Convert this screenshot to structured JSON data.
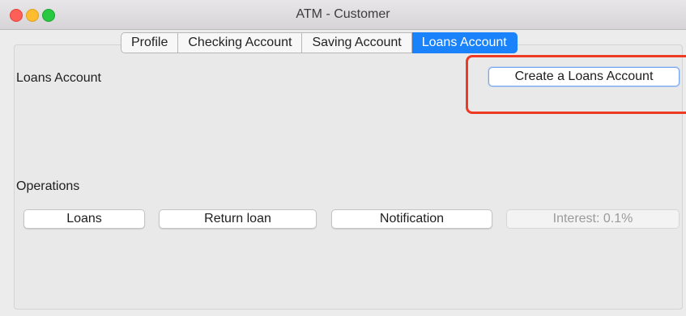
{
  "window": {
    "title": "ATM - Customer"
  },
  "tabs": [
    {
      "label": "Profile",
      "active": false
    },
    {
      "label": "Checking Account",
      "active": false
    },
    {
      "label": "Saving Account",
      "active": false
    },
    {
      "label": "Loans Account",
      "active": true
    }
  ],
  "panel": {
    "section_title": "Loans Account",
    "create_button": "Create a Loans Account",
    "operations_title": "Operations",
    "operations": {
      "loans": "Loans",
      "return_loan": "Return loan",
      "notification": "Notification",
      "interest": "Interest: 0.1%"
    }
  },
  "colors": {
    "active_tab": "#1a82fb",
    "highlight": "#ee3a22",
    "close": "#fe5f57",
    "minimize": "#febc2e",
    "maximize": "#28c840"
  }
}
